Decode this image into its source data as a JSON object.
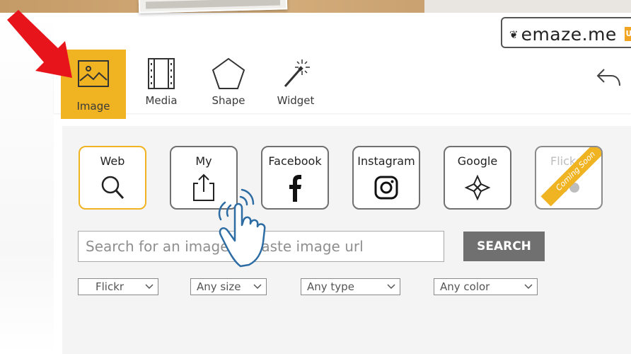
{
  "logo": {
    "text": "emaze.me",
    "badge": "U"
  },
  "toolbar": {
    "items": [
      {
        "label": "Image",
        "icon": "image-icon",
        "active": true
      },
      {
        "label": "Media",
        "icon": "film-icon",
        "active": false
      },
      {
        "label": "Shape",
        "icon": "pentagon-icon",
        "active": false
      },
      {
        "label": "Widget",
        "icon": "magic-wand-icon",
        "active": false
      }
    ],
    "undo_icon": "undo-arrow-icon"
  },
  "sources": [
    {
      "label": "Web",
      "icon": "magnifier-icon",
      "state": "selected"
    },
    {
      "label": "My",
      "icon": "upload-icon",
      "state": "normal"
    },
    {
      "label": "Facebook",
      "icon": "facebook-icon",
      "state": "normal"
    },
    {
      "label": "Instagram",
      "icon": "instagram-icon",
      "state": "normal"
    },
    {
      "label": "Google",
      "icon": "google-drive-icon",
      "state": "normal"
    },
    {
      "label": "Flicker",
      "icon": "flickr-icon",
      "state": "disabled",
      "ribbon": "Coming Soon"
    }
  ],
  "search": {
    "placeholder": "Search for an image or paste image url",
    "value": "",
    "button_label": "SEARCH"
  },
  "filters": {
    "provider": "Flickr",
    "size": "Any size",
    "type": "Any type",
    "color": "Any color"
  },
  "colors": {
    "accent": "#f0b322",
    "red_arrow": "#e8141b",
    "hand_cursor": "#2e6da4",
    "search_button": "#707070"
  },
  "overlays": {
    "arrow": "red-pointer-arrow",
    "cursor": "tapping-hand-cursor"
  }
}
